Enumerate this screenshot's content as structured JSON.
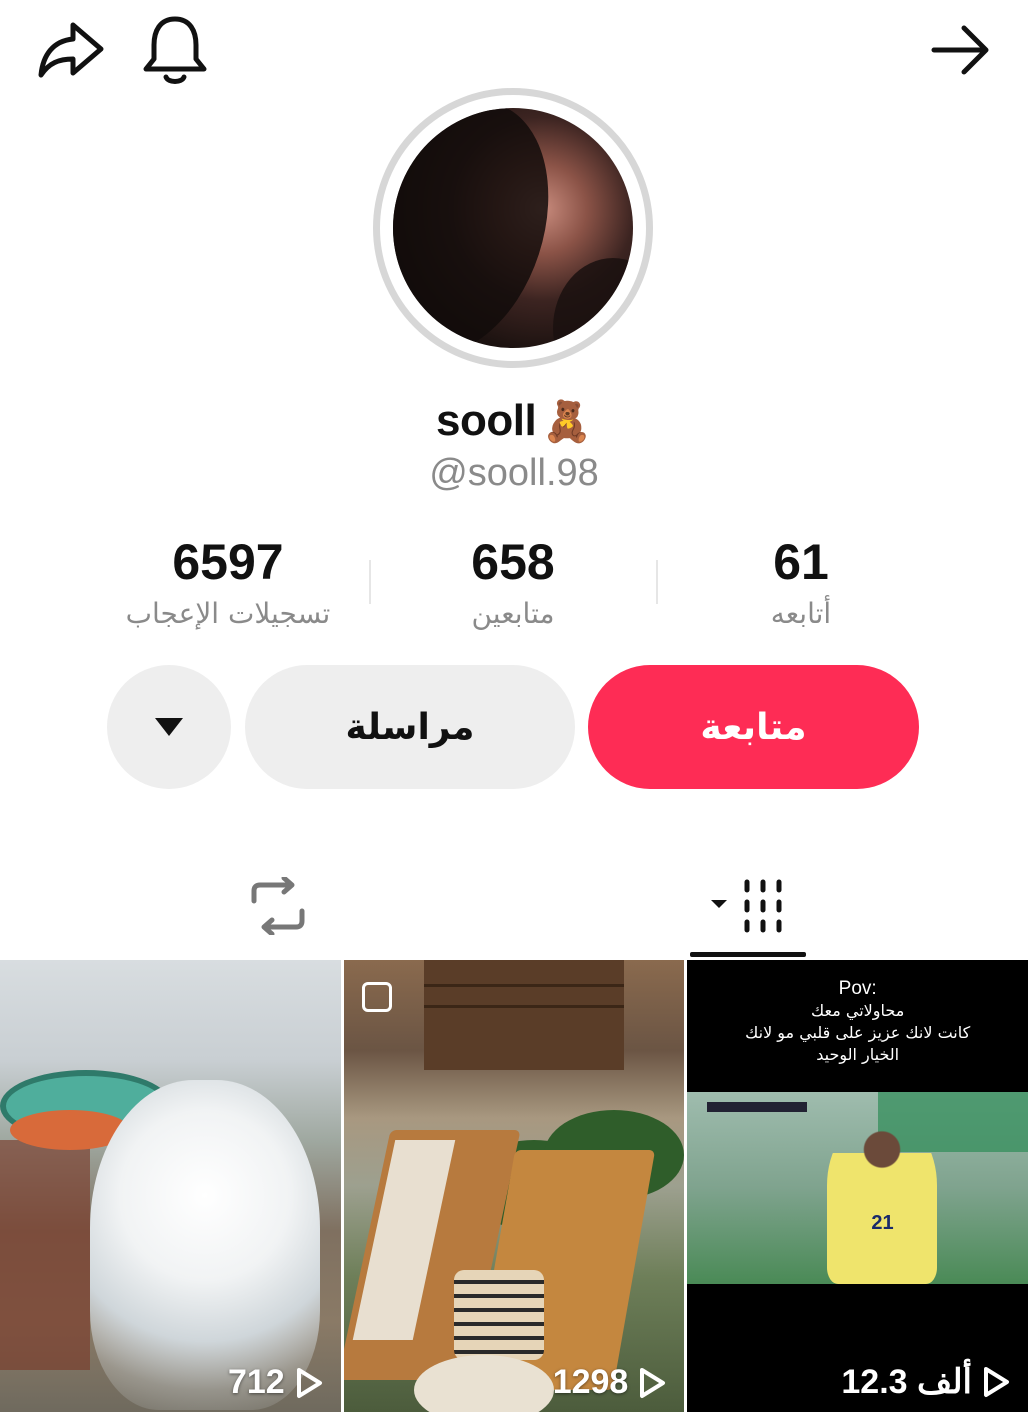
{
  "header": {
    "share_icon": "share-arrow-icon",
    "bell_icon": "bell-icon",
    "back_icon": "arrow-right-icon"
  },
  "profile": {
    "display_name": "sooll",
    "name_emoji": "🧸",
    "username": "@sooll.98",
    "avatar_ring_color": "#d7d7d7"
  },
  "stats": {
    "following": {
      "value": "61",
      "label": "أتابعه"
    },
    "followers": {
      "value": "658",
      "label": "متابعين"
    },
    "likes": {
      "value": "6597",
      "label": "تسجيلات الإعجاب"
    }
  },
  "actions": {
    "follow_label": "متابعة",
    "message_label": "مراسلة",
    "more_icon": "caret-down-icon",
    "follow_color": "#fe2c55"
  },
  "tabs": {
    "videos_icon": "grid-columns-icon",
    "reposts_icon": "repost-icon"
  },
  "videos": [
    {
      "views": "12.3 ألف",
      "caption_title": "Pov:",
      "caption_lines": [
        "محاولاتي معك",
        "كانت لانك عزيز على قلبي مو لانك",
        "الخيار الوحيد"
      ],
      "jersey": "21"
    },
    {
      "views": "1298"
    },
    {
      "views": "712"
    }
  ]
}
